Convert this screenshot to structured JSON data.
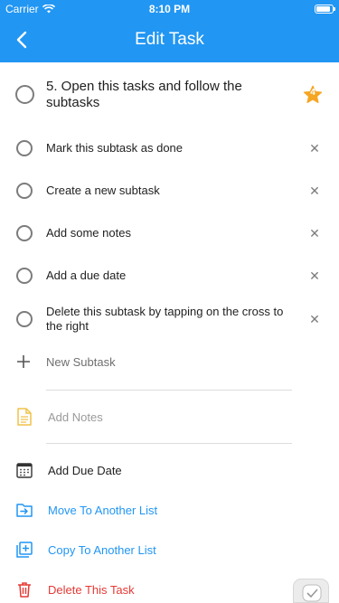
{
  "status_bar": {
    "carrier": "Carrier",
    "time": "8:10 PM",
    "battery_level": 0.9
  },
  "nav": {
    "title": "Edit Task"
  },
  "task": {
    "title": "5. Open this tasks and follow the subtasks",
    "priority": "4"
  },
  "subtasks": [
    {
      "label": "Mark this subtask as done"
    },
    {
      "label": "Create a new subtask"
    },
    {
      "label": "Add some notes"
    },
    {
      "label": "Add a due date"
    },
    {
      "label": "Delete this subtask by tapping on the cross to the right"
    }
  ],
  "new_subtask": {
    "placeholder": "New Subtask"
  },
  "notes": {
    "placeholder": "Add Notes"
  },
  "actions": {
    "due_date": "Add Due Date",
    "move": "Move To Another List",
    "copy": "Copy To Another List",
    "delete": "Delete This Task"
  },
  "colors": {
    "accent": "#2196f3",
    "priority_star": "#f5a623",
    "notes_icon": "#f0c24a",
    "delete": "#e53935"
  }
}
